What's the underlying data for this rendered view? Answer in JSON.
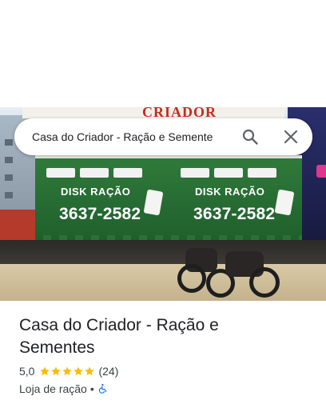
{
  "search": {
    "query": "Casa do Criador - Ração e Semente",
    "search_icon": "search-icon",
    "close_icon": "close-icon"
  },
  "photo": {
    "header_brand": "CRIADOR",
    "awning_text": "DISK RAÇÃO",
    "awning_phone": "3637-2582"
  },
  "place": {
    "title": "Casa do Criador - Ração e Sementes",
    "rating": "5,0",
    "stars": 5,
    "review_count": "(24)",
    "category": "Loja de ração",
    "separator": "•",
    "accessibility_icon": "wheelchair-icon"
  },
  "colors": {
    "star": "#fbbc04",
    "accessibility": "#1a73e8",
    "text": "#202124",
    "secondary_text": "#3c4043"
  }
}
